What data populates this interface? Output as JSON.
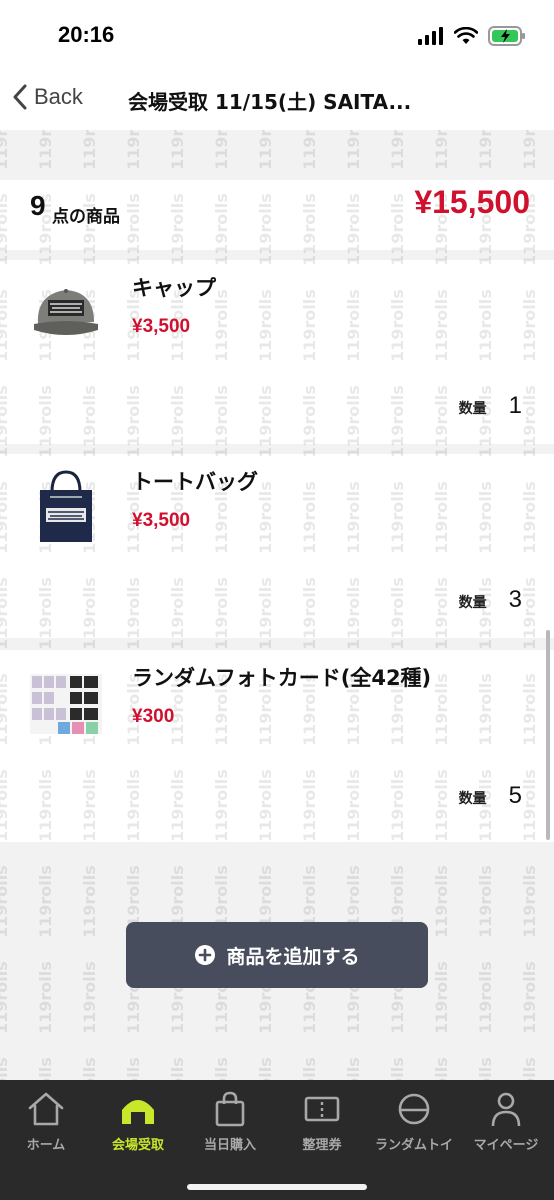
{
  "status_bar": {
    "time": "20:16"
  },
  "nav": {
    "back_label": "Back",
    "title": "会場受取 11/15(土) SAITA..."
  },
  "summary": {
    "count": "9",
    "count_label": "点の商品",
    "total": "¥15,500"
  },
  "items": [
    {
      "name": "キャップ",
      "price": "¥3,500",
      "qty_label": "数量",
      "qty": "1",
      "thumb_icon": "cap-thumbnail"
    },
    {
      "name": "トートバッグ",
      "price": "¥3,500",
      "qty_label": "数量",
      "qty": "3",
      "thumb_icon": "tote-bag-thumbnail"
    },
    {
      "name": "ランダムフォトカード(全42種)",
      "price": "¥300",
      "qty_label": "数量",
      "qty": "5",
      "thumb_icon": "photocard-thumbnail"
    }
  ],
  "add_button": {
    "label": "商品を追加する",
    "icon": "plus-circle-icon"
  },
  "watermark": {
    "text": "119rolls"
  },
  "tabs": [
    {
      "label": "ホーム",
      "icon": "home-icon"
    },
    {
      "label": "会場受取",
      "icon": "venue-pickup-icon"
    },
    {
      "label": "当日購入",
      "icon": "shopping-bag-icon"
    },
    {
      "label": "整理券",
      "icon": "ticket-icon"
    },
    {
      "label": "ランダムトイ",
      "icon": "capsule-toy-icon"
    },
    {
      "label": "マイページ",
      "icon": "user-icon"
    }
  ],
  "colors": {
    "price": "#d0102f",
    "tabbar_bg": "#2a2a2a",
    "tab_active": "#c8e62a",
    "button_bg": "#474d5c"
  }
}
